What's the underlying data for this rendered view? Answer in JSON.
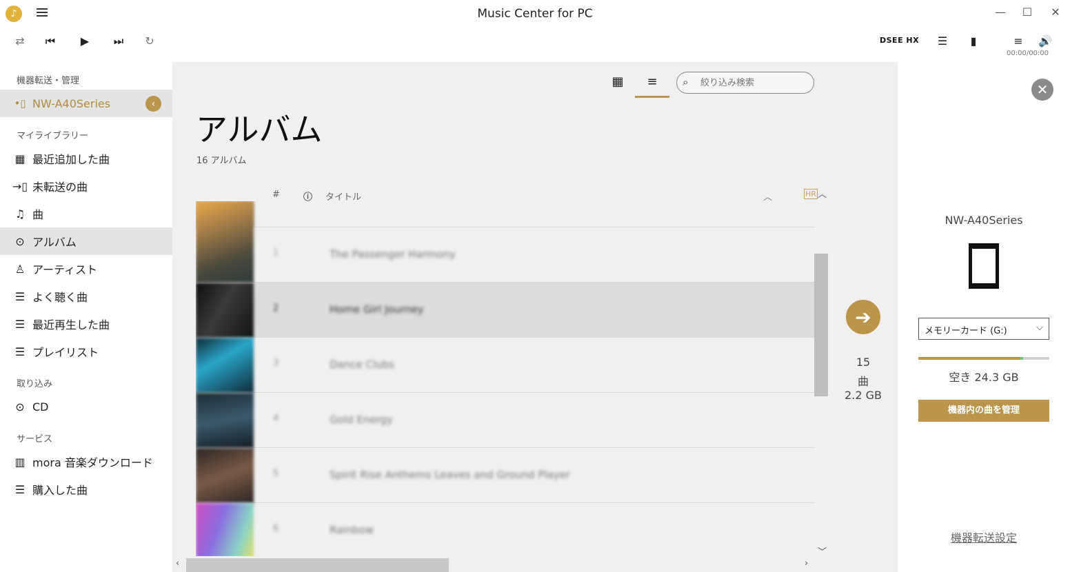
{
  "window": {
    "title": "Music Center for PC",
    "app_icon": "music-note-icon",
    "minimize": "—",
    "maximize": "☐",
    "close": "✕"
  },
  "transport": {
    "dsee_label": "DSEE HX",
    "time": "00:00/00:00",
    "icons": [
      "shuffle-icon",
      "previous-icon",
      "play-icon",
      "next-icon",
      "repeat-icon",
      "equalizer-icon",
      "speaker-icon",
      "queue-icon",
      "volume-icon"
    ]
  },
  "sidebar": {
    "device_section": "機器転送・管理",
    "device_name": "NW-A40Series",
    "library_section": "マイライブラリー",
    "library_items": [
      {
        "label": "最近追加した曲",
        "icon": "calendar-icon"
      },
      {
        "label": "未転送の曲",
        "icon": "untransferred-icon"
      },
      {
        "label": "曲",
        "icon": "music-note-icon"
      },
      {
        "label": "アルバム",
        "icon": "disc-icon",
        "active": true
      },
      {
        "label": "アーティスト",
        "icon": "person-icon"
      },
      {
        "label": "よく聴く曲",
        "icon": "playlist-icon"
      },
      {
        "label": "最近再生した曲",
        "icon": "playlist-icon"
      },
      {
        "label": "プレイリスト",
        "icon": "playlist-icon"
      }
    ],
    "import_section": "取り込み",
    "import_items": [
      {
        "label": "CD",
        "icon": "disc-icon"
      }
    ],
    "service_section": "サービス",
    "service_items": [
      {
        "label": "mora 音楽ダウンロード",
        "icon": "mora-icon"
      },
      {
        "label": "購入した曲",
        "icon": "playlist-icon"
      }
    ]
  },
  "main": {
    "search_placeholder": "絞り込み検索",
    "title": "アルバム",
    "count": "16 アルバム",
    "columns": {
      "num": "#",
      "title": "タイトル",
      "hr": "HR"
    },
    "rows": [
      {
        "num": "1",
        "title": "The Passenger Harmony",
        "colors": [
          "#e9a94a",
          "#4b4a3e"
        ]
      },
      {
        "num": "2",
        "title": "Home Girl Journey",
        "colors": [
          "#1a1a1a",
          "#5a5a5a"
        ],
        "selected": true
      },
      {
        "num": "3",
        "title": "Dance Clubs",
        "colors": [
          "#2aa6c9",
          "#0e2a36"
        ]
      },
      {
        "num": "4",
        "title": "Gold Energy",
        "colors": [
          "#1d2c35",
          "#3b5a6b"
        ]
      },
      {
        "num": "5",
        "title": "Spirit Rise Anthems Leaves and Ground Player",
        "colors": [
          "#5a3e36",
          "#2b2625"
        ]
      },
      {
        "num": "6",
        "title": "Rainbow",
        "colors": [
          "#d14dbf",
          "#8ad3c6"
        ]
      }
    ]
  },
  "transfer": {
    "count": "15",
    "unit": "曲",
    "size": "2.2 GB"
  },
  "device_panel": {
    "name": "NW-A40Series",
    "storage": "メモリーカード (G:)",
    "used_fraction": 0.78,
    "free": "空き 24.3 GB",
    "manage_button": "機器内の曲を管理",
    "settings_link": "機器転送設定"
  }
}
